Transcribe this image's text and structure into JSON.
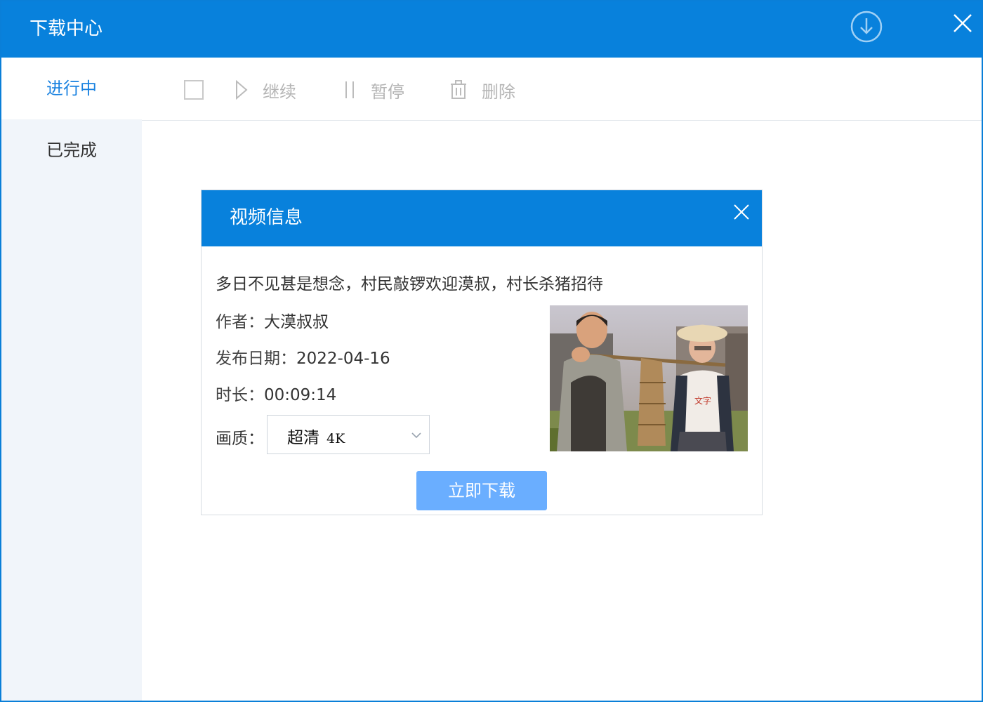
{
  "window": {
    "title": "下载中心",
    "accent_color": "#0881dc",
    "icons": {
      "download": "download-circle-icon",
      "close": "close-icon"
    }
  },
  "sidebar": {
    "items": [
      {
        "label": "进行中",
        "active": true
      },
      {
        "label": "已完成",
        "active": false
      }
    ]
  },
  "toolbar": {
    "continue_label": "继续",
    "pause_label": "暂停",
    "delete_label": "删除"
  },
  "dialog": {
    "title": "视频信息",
    "video_title": "多日不见甚是想念，村民敲锣欢迎漠叔，村长杀猪招待",
    "author_label": "作者：",
    "author": "大漠叔叔",
    "date_label": "发布日期：",
    "date": "2022-04-16",
    "duration_label": "时长：",
    "duration": "00:09:14",
    "quality_label": "画质：",
    "quality_selected": "超清",
    "quality_res": "4K",
    "download_button": "立即下载",
    "button_color": "#6aaeff"
  }
}
